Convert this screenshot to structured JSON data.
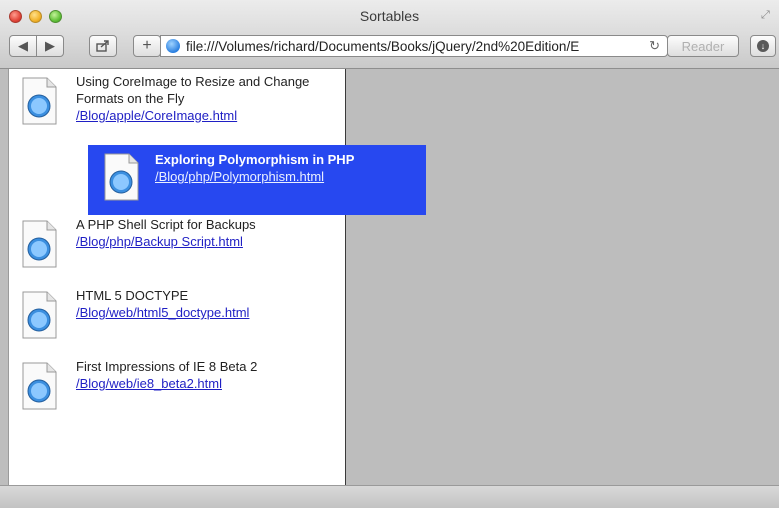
{
  "window": {
    "title": "Sortables"
  },
  "toolbar": {
    "back_icon": "back-arrow-icon",
    "forward_icon": "forward-arrow-icon",
    "share_icon": "share-icon",
    "add_icon": "plus-icon",
    "address": "file:///Volumes/richard/Documents/Books/jQuery/2nd%20Edition/E",
    "reload_icon": "reload-icon",
    "reader_label": "Reader",
    "downloads_icon": "download-icon"
  },
  "list": {
    "items": [
      {
        "title": "Using CoreImage to Resize and Change Formats on the Fly",
        "link": "/Blog/apple/CoreImage.html"
      },
      {
        "title": "A PHP Shell Script for Backups",
        "link": "/Blog/php/Backup Script.html"
      },
      {
        "title": "HTML 5 DOCTYPE",
        "link": "/Blog/web/html5_doctype.html"
      },
      {
        "title": "First Impressions of IE 8 Beta 2",
        "link": "/Blog/web/ie8_beta2.html"
      }
    ],
    "dragging": {
      "title": "Exploring Polymorphism in PHP",
      "link": "/Blog/php/Polymorphism.html"
    }
  },
  "colors": {
    "drag_highlight": "#2748f0",
    "link": "#1f1fc4"
  }
}
